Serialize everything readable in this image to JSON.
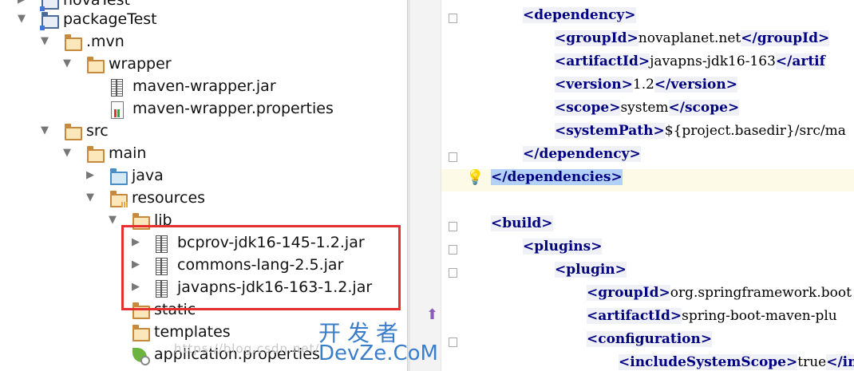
{
  "project_tree": {
    "rows": [
      {
        "label": "novaTest",
        "icon": "project-folder-icon"
      },
      {
        "label": "packageTest",
        "icon": "project-folder-icon"
      },
      {
        "label": ".mvn",
        "icon": "folder-icon"
      },
      {
        "label": "wrapper",
        "icon": "folder-icon"
      },
      {
        "label": "maven-wrapper.jar",
        "icon": "jar-icon"
      },
      {
        "label": "maven-wrapper.properties",
        "icon": "properties-file-icon"
      },
      {
        "label": "src",
        "icon": "folder-icon"
      },
      {
        "label": "main",
        "icon": "folder-icon"
      },
      {
        "label": "java",
        "icon": "source-folder-icon"
      },
      {
        "label": "resources",
        "icon": "resources-folder-icon"
      },
      {
        "label": "lib",
        "icon": "folder-icon"
      },
      {
        "label": "bcprov-jdk16-145-1.2.jar",
        "icon": "jar-icon"
      },
      {
        "label": "commons-lang-2.5.jar",
        "icon": "jar-icon"
      },
      {
        "label": "javapns-jdk16-163-1.2.jar",
        "icon": "jar-icon"
      },
      {
        "label": "static",
        "icon": "folder-icon"
      },
      {
        "label": "templates",
        "icon": "folder-icon"
      },
      {
        "label": "application.properties",
        "icon": "spring-properties-icon"
      }
    ],
    "highlight_color": "#e53030"
  },
  "editor": {
    "lines": [
      {
        "parts": [
          [
            "tag",
            "<dependency>"
          ]
        ]
      },
      {
        "parts": [
          [
            "tag",
            "<groupId>"
          ],
          [
            "txt",
            "novaplanet.net"
          ],
          [
            "tag",
            "</groupId>"
          ]
        ]
      },
      {
        "parts": [
          [
            "tag",
            "<artifactId>"
          ],
          [
            "txt",
            "javapns-jdk16-163"
          ],
          [
            "tag",
            "</artif"
          ]
        ]
      },
      {
        "parts": [
          [
            "tag",
            "<version>"
          ],
          [
            "txt",
            "1.2"
          ],
          [
            "tag",
            "</version>"
          ]
        ]
      },
      {
        "parts": [
          [
            "tag",
            "<scope>"
          ],
          [
            "txt",
            "system"
          ],
          [
            "tag",
            "</scope>"
          ]
        ]
      },
      {
        "parts": [
          [
            "tag",
            "<systemPath>"
          ],
          [
            "txt",
            "${project.basedir}/src/ma"
          ]
        ]
      },
      {
        "parts": [
          [
            "tag",
            "</dependency>"
          ]
        ]
      },
      {
        "parts": [
          [
            "tag",
            "</dependencies>"
          ]
        ]
      },
      {
        "parts": []
      },
      {
        "parts": [
          [
            "tag",
            "<build>"
          ]
        ]
      },
      {
        "parts": [
          [
            "tag",
            "<plugins>"
          ]
        ]
      },
      {
        "parts": [
          [
            "tag",
            "<plugin>"
          ]
        ]
      },
      {
        "parts": [
          [
            "tag",
            "<groupId>"
          ],
          [
            "txt",
            "org.springframework.boot"
          ]
        ]
      },
      {
        "parts": [
          [
            "tag",
            "<artifactId>"
          ],
          [
            "txt",
            "spring-boot-maven-plu"
          ]
        ]
      },
      {
        "parts": [
          [
            "tag",
            "<configuration>"
          ]
        ]
      },
      {
        "parts": [
          [
            "tag",
            "<includeSystemScope>"
          ],
          [
            "txt",
            "true"
          ],
          [
            "tag",
            "</in"
          ]
        ]
      }
    ],
    "tag_color": "#000080"
  },
  "watermark": {
    "url": "https://blog.csdn.net/",
    "brand_cn": "开发者",
    "brand_en": "DevZe.CoM"
  }
}
